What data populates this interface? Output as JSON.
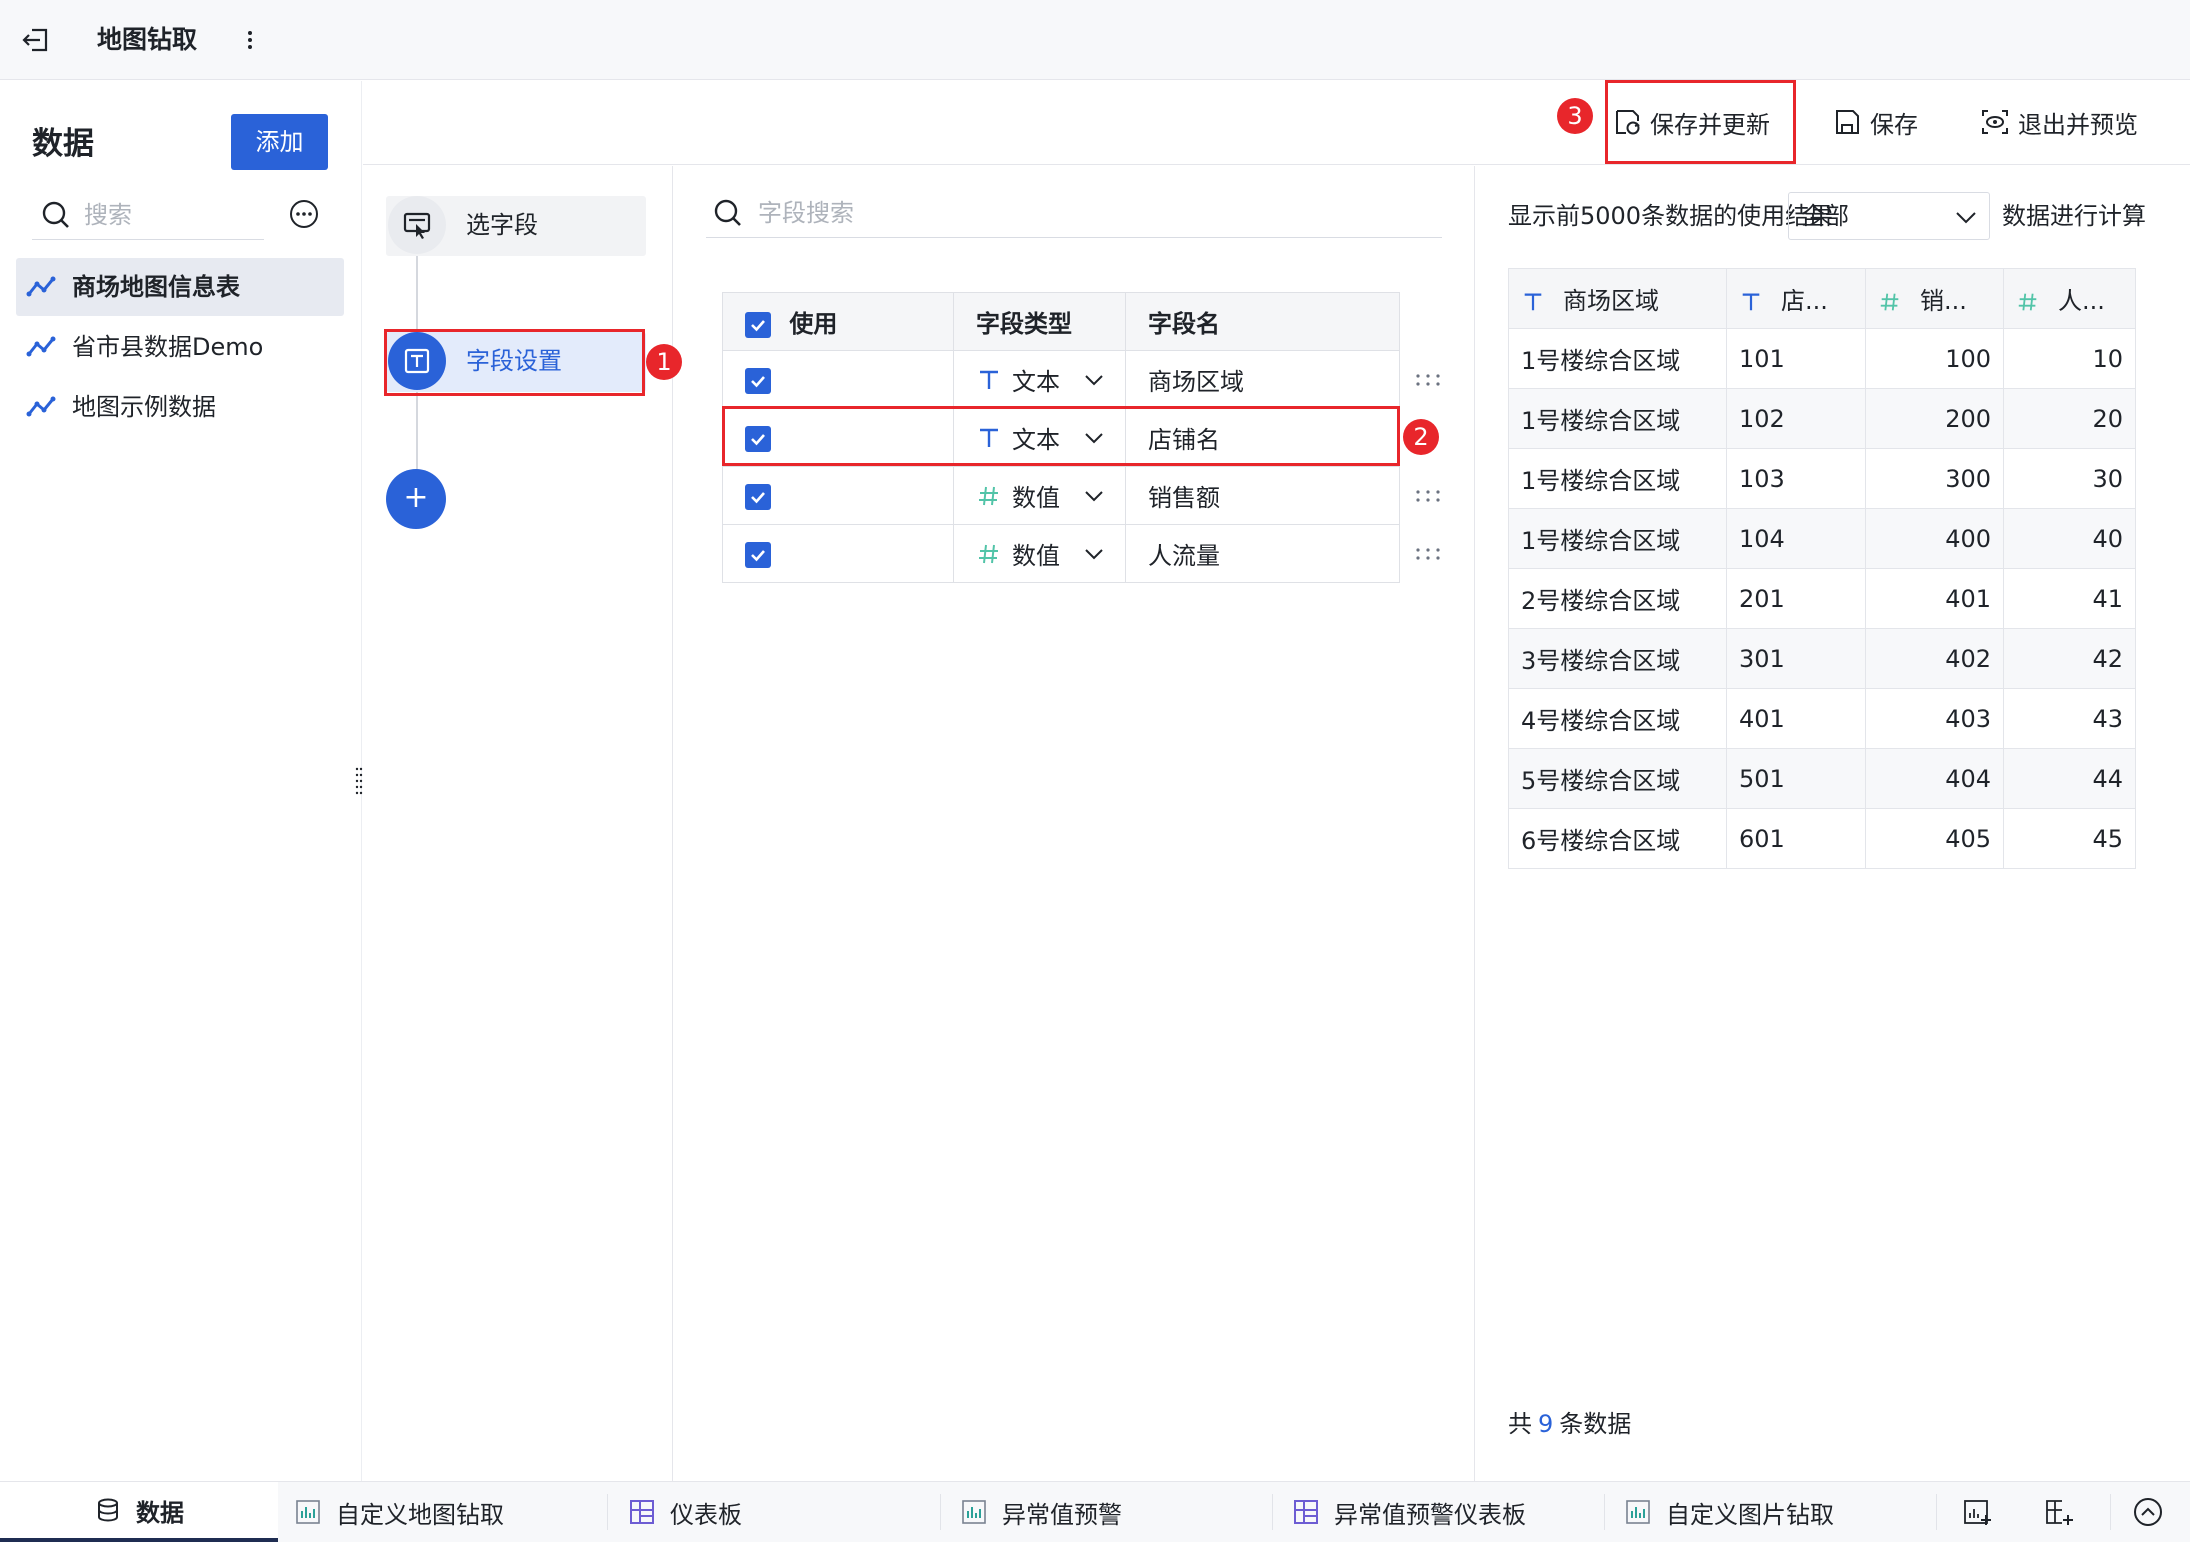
{
  "app": {
    "title": "地图钻取"
  },
  "sidebar": {
    "title": "数据",
    "add_label": "添加",
    "search_placeholder": "搜索",
    "items": [
      {
        "label": "商场地图信息表",
        "active": true
      },
      {
        "label": "省市县数据Demo",
        "active": false
      },
      {
        "label": "地图示例数据",
        "active": false
      }
    ]
  },
  "toolbar": {
    "save_update_label": "保存并更新",
    "save_label": "保存",
    "exit_preview_label": "退出并预览",
    "badge": "3"
  },
  "steps": {
    "items": [
      {
        "label": "选字段"
      },
      {
        "label": "字段设置",
        "badge": "1"
      }
    ]
  },
  "fields": {
    "search_placeholder": "字段搜索",
    "columns": [
      "使用",
      "字段类型",
      "字段名"
    ],
    "rows": [
      {
        "type": "文本",
        "type_icon": "text-type-icon",
        "name": "商场区域",
        "checked": true
      },
      {
        "type": "文本",
        "type_icon": "text-type-icon",
        "name": "店铺名",
        "checked": true,
        "badge": "2"
      },
      {
        "type": "数值",
        "type_icon": "number-type-icon",
        "name": "销售额",
        "checked": true
      },
      {
        "type": "数值",
        "type_icon": "number-type-icon",
        "name": "人流量",
        "checked": true
      }
    ]
  },
  "preview": {
    "note_prefix": "显示前5000条数据的使用结果",
    "select_value": "全部",
    "note_suffix": "数据进行计算",
    "columns": [
      "商场区域",
      "店...",
      "销...",
      "人..."
    ],
    "rows": [
      [
        "1号楼综合区域",
        "101",
        "100",
        "10"
      ],
      [
        "1号楼综合区域",
        "102",
        "200",
        "20"
      ],
      [
        "1号楼综合区域",
        "103",
        "300",
        "30"
      ],
      [
        "1号楼综合区域",
        "104",
        "400",
        "40"
      ],
      [
        "2号楼综合区域",
        "201",
        "401",
        "41"
      ],
      [
        "3号楼综合区域",
        "301",
        "402",
        "42"
      ],
      [
        "4号楼综合区域",
        "401",
        "403",
        "43"
      ],
      [
        "5号楼综合区域",
        "501",
        "404",
        "44"
      ],
      [
        "6号楼综合区域",
        "601",
        "405",
        "45"
      ]
    ],
    "count_prefix": "共",
    "count": "9",
    "count_suffix": "条数据"
  },
  "bottom_tabs": [
    {
      "label": "数据",
      "active": true
    },
    {
      "label": "自定义地图钻取"
    },
    {
      "label": "仪表板"
    },
    {
      "label": "异常值预警"
    },
    {
      "label": "异常值预警仪表板"
    },
    {
      "label": "自定义图片钻取"
    }
  ],
  "colors": {
    "accent": "#2a62d8",
    "highlight": "#e8262b"
  }
}
